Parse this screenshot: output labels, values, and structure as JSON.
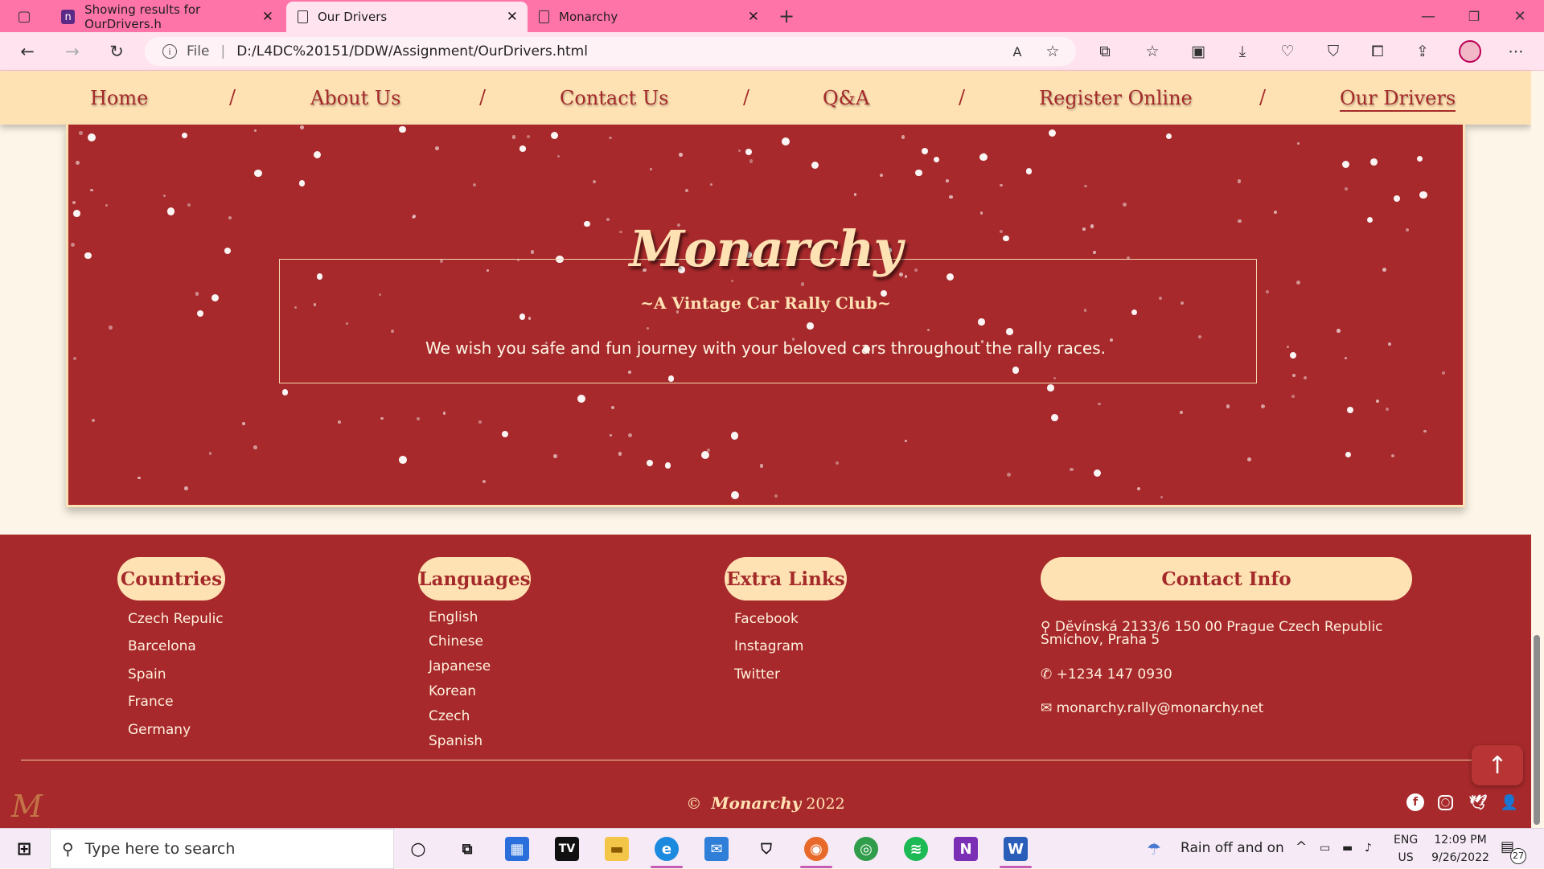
{
  "browser": {
    "tabs": [
      {
        "title": "Showing results for OurDrivers.h",
        "icon": "site-favicon"
      },
      {
        "title": "Our Drivers",
        "icon": "page-icon"
      },
      {
        "title": "Monarchy",
        "icon": "page-icon"
      }
    ],
    "address": {
      "scheme_label": "File",
      "url": "D:/L4DC%20151/DDW/Assignment/OurDrivers.html"
    }
  },
  "nav": {
    "items": [
      {
        "label": "Home"
      },
      {
        "label": "About Us"
      },
      {
        "label": "Contact Us"
      },
      {
        "label": "Q&A"
      },
      {
        "label": "Register Online"
      },
      {
        "label": "Our Drivers"
      }
    ],
    "separator": "/",
    "active_item": "Our Drivers"
  },
  "hero": {
    "brand": "Monarchy",
    "tagline": "~A Vintage Car Rally Club~",
    "message": "We wish you safe and fun journey with your beloved cars throughout the rally races."
  },
  "footer": {
    "countries": {
      "title": "Countries",
      "items": [
        "Czech Repulic",
        "Barcelona",
        "Spain",
        "France",
        "Germany"
      ]
    },
    "languages": {
      "title": "Languages",
      "items": [
        "English",
        "Chinese",
        "Japanese",
        "Korean",
        "Czech",
        "Spanish"
      ]
    },
    "extra_links": {
      "title": "Extra Links",
      "items": [
        "Facebook",
        "Instagram",
        "Twitter"
      ]
    },
    "contact": {
      "title": "Contact Info",
      "address_line1": "Dĕvínská 2133/6 150 00 Prague Czech Republic",
      "address_line2": "Smíchov, Praha 5",
      "phone": "+1234 147 0930",
      "email": "monarchy.rally@monarchy.net"
    },
    "copyright_symbol": "©",
    "copyright_brand": "Monarchy",
    "copyright_year": "2022",
    "social_icons": [
      "facebook-icon",
      "instagram-icon",
      "twitter-icon",
      "user-icon"
    ]
  },
  "taskbar": {
    "search_placeholder": "Type here to search",
    "weather": "Rain off and on",
    "language": "ENG",
    "region": "US",
    "time": "12:09 PM",
    "date": "9/26/2022",
    "notifications": "27"
  },
  "colors": {
    "primary": "#a7292b",
    "cream": "#ffe2b4",
    "tabbar": "#ff74a8"
  }
}
